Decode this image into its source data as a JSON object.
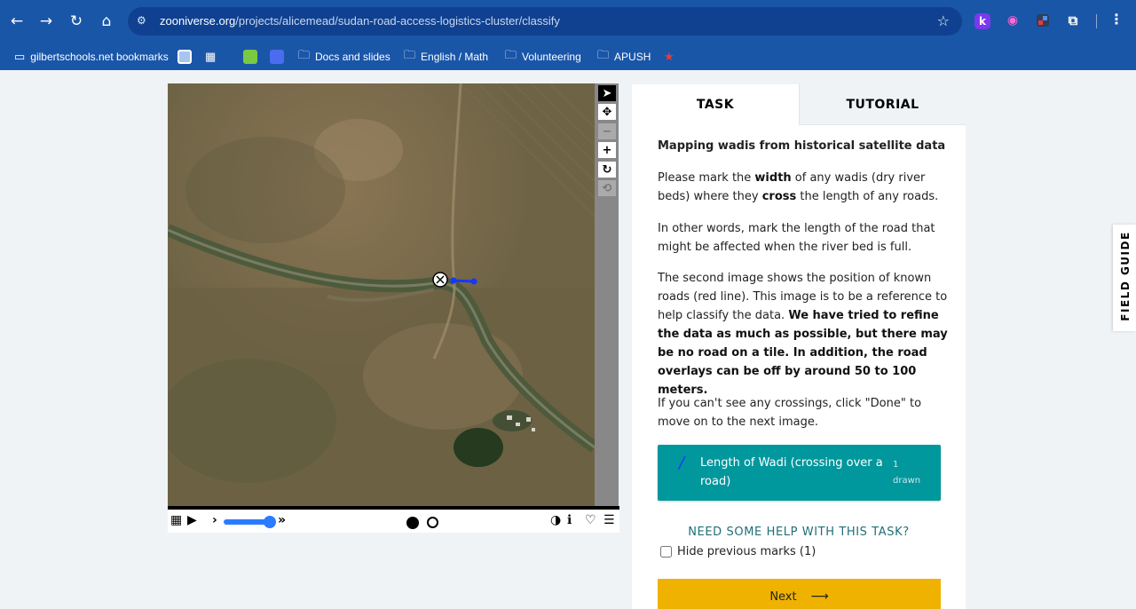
{
  "browser": {
    "url_host": "zooniverse.org",
    "url_path": "/projects/alicemead/sudan-road-access-logistics-cluster/classify",
    "extensions": [
      "k-extension-icon",
      "video-extension-icon",
      "extension-icon",
      "puzzle-icon"
    ]
  },
  "bookmarks": {
    "items": [
      {
        "label": "gilbertschools.net bookmarks",
        "icon": "bookmark-folder-icon"
      },
      {
        "label": "Docs and slides",
        "icon": "folder-icon"
      },
      {
        "label": "English / Math",
        "icon": "folder-icon"
      },
      {
        "label": "Volunteering",
        "icon": "folder-icon"
      },
      {
        "label": "APUSH",
        "icon": "folder-icon"
      }
    ]
  },
  "tabs": {
    "task": "TASK",
    "tutorial": "TUTORIAL"
  },
  "task": {
    "title": "Mapping wadis from historical satellite data",
    "p1_pre": "Please mark the ",
    "p1_b1": "width",
    "p1_mid": " of any wadis (dry river beds) where they ",
    "p1_b2": "cross",
    "p1_post": " the length of any roads.",
    "p2": "In other words, mark the length of the road that might be affected when the river bed is full.",
    "p3_pre": "The second image shows the position of known roads (red line). This image is to be a reference to help classify the data. ",
    "p3_bold": "We have tried to refine the data as much as possible, but there may be no road on a tile. In addition, the road overlays can be off by around 50 to 100 meters.",
    "p4": "If you can't see any crossings, click \"Done\" to move on to the next image.",
    "tool_label": "Length of Wadi (crossing over a road)",
    "tool_count": "1 drawn",
    "help_link": "NEED SOME HELP WITH THIS TASK?",
    "hide_previous": "Hide previous marks (1)",
    "next_label": "Next",
    "next_arrow": "⟶"
  },
  "field_guide": "FIELD GUIDE",
  "colors": {
    "chrome": "#1a56a8",
    "tool_button": "#00979d",
    "next_button": "#f0b200",
    "mark_line": "#1537ff"
  }
}
